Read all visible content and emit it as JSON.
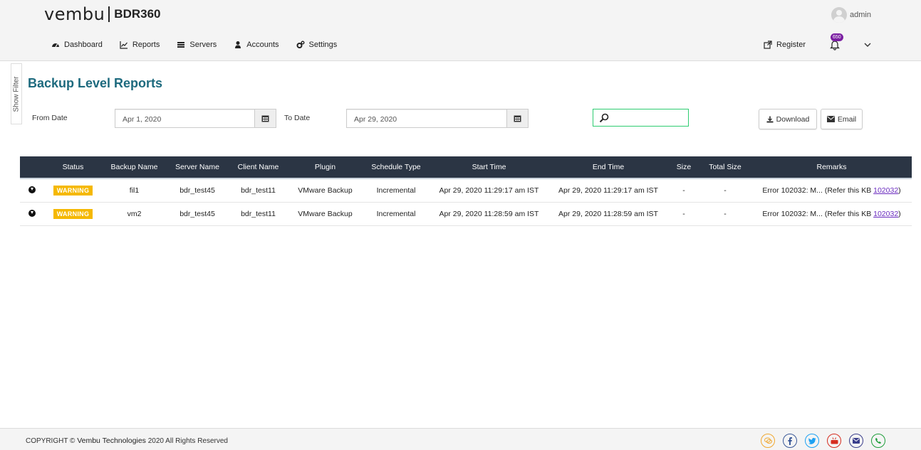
{
  "brand": {
    "name": "vembu",
    "product": "BDR360"
  },
  "user": {
    "name": "admin"
  },
  "nav": {
    "items": [
      {
        "label": "Dashboard"
      },
      {
        "label": "Reports"
      },
      {
        "label": "Servers"
      },
      {
        "label": "Accounts"
      },
      {
        "label": "Settings"
      }
    ],
    "register_label": "Register",
    "notification_count": "650"
  },
  "filter_tab_label": "Show Filter",
  "page_title": "Backup Level Reports",
  "filters": {
    "from_label": "From Date",
    "from_value": "Apr 1, 2020",
    "to_label": "To Date",
    "to_value": "Apr 29, 2020",
    "search_value": "",
    "download_label": "Download",
    "email_label": "Email"
  },
  "table": {
    "headers": [
      "Status",
      "Backup Name",
      "Server Name",
      "Client Name",
      "Plugin",
      "Schedule Type",
      "Start Time",
      "End Time",
      "Size",
      "Total Size",
      "Remarks"
    ],
    "rows": [
      {
        "status": "WARNING",
        "backup_name": "fil1",
        "server_name": "bdr_test45",
        "client_name": "bdr_test11",
        "plugin": "VMware Backup",
        "schedule_type": "Incremental",
        "start_time": "Apr 29, 2020 11:29:17 am IST",
        "end_time": "Apr 29, 2020 11:29:17 am IST",
        "size": "-",
        "total_size": "-",
        "remarks": "Error 102032: M... (Refer this KB ",
        "kb": "102032",
        "remarks_end": ")"
      },
      {
        "status": "WARNING",
        "backup_name": "vm2",
        "server_name": "bdr_test45",
        "client_name": "bdr_test11",
        "plugin": "VMware Backup",
        "schedule_type": "Incremental",
        "start_time": "Apr 29, 2020 11:28:59 am IST",
        "end_time": "Apr 29, 2020 11:28:59 am IST",
        "size": "-",
        "total_size": "-",
        "remarks": "Error 102032: M... (Refer this KB ",
        "kb": "102032",
        "remarks_end": ")"
      }
    ]
  },
  "footer": {
    "copyright_prefix": "COPYRIGHT ©",
    "company": "Vembu Technologies",
    "copyright_suffix": "2020 All Rights Reserved"
  },
  "colors": {
    "accent_title": "#1d6a7e",
    "table_header": "#2b3544",
    "warning": "#f5b800",
    "search_border": "#2ecc71"
  },
  "social_icons": [
    "chat-icon",
    "facebook-icon",
    "twitter-icon",
    "youtube-icon",
    "email-icon",
    "whatsapp-icon"
  ]
}
